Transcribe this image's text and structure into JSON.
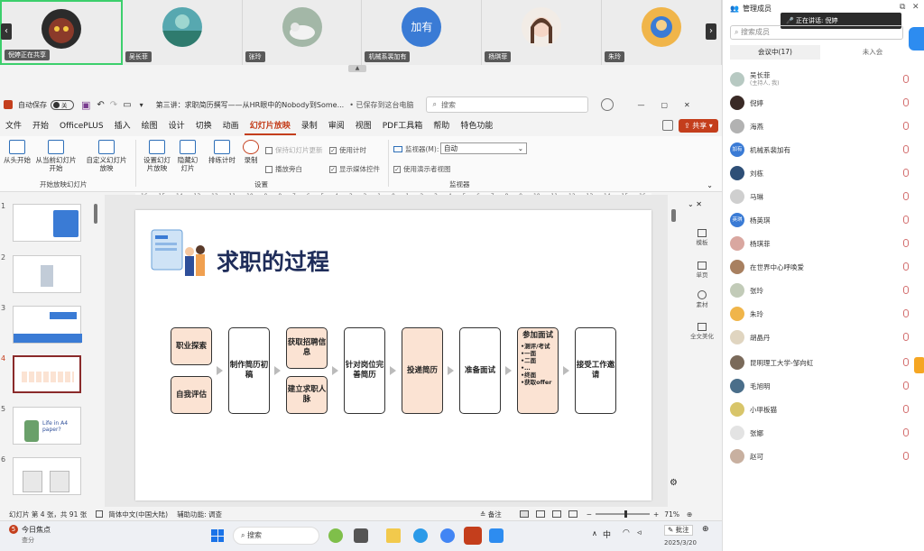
{
  "video_strip": {
    "tiles": [
      {
        "name": "倪婷正在共享",
        "avatar_color": "#2b2b2b",
        "active": true
      },
      {
        "name": "吴长菲",
        "avatar_color": "#57a8b0"
      },
      {
        "name": "张玲",
        "avatar_color": "#a3b7a7"
      },
      {
        "name": "机械系裴加有",
        "avatar_text": "加有",
        "avatar_color": "#3a7bd5"
      },
      {
        "name": "杨琪菲",
        "avatar_color": "#d9c4b8"
      },
      {
        "name": "朱玲",
        "avatar_color": "#f0b54a"
      }
    ],
    "left_arrow": "‹",
    "right_arrow": "›"
  },
  "titlebar": {
    "autosave_label": "自动保存",
    "autosave_state": "关",
    "doc_title": "第三讲：求职简历撰写——从HR眼中的Nobody到Some...",
    "save_status": "• 已保存到这台电脑",
    "search_placeholder": "搜索"
  },
  "menubar": {
    "items": [
      "文件",
      "开始",
      "OfficePLUS",
      "插入",
      "绘图",
      "设计",
      "切换",
      "动画",
      "幻灯片放映",
      "录制",
      "审阅",
      "视图",
      "PDF工具箱",
      "帮助",
      "特色功能"
    ],
    "selected_index": 8,
    "share_label": "共享"
  },
  "ribbon": {
    "btn_from_start": "从头开始",
    "btn_from_current": "从当前幻灯片开始",
    "btn_custom": "自定义幻灯片放映",
    "group_start": "开始放映幻灯片",
    "btn_setup": "设置幻灯片放映",
    "btn_hide": "隐藏幻灯片",
    "btn_rehearse": "排练计时",
    "btn_record": "录制",
    "chk_keep_updated": "保持幻灯片更新",
    "chk_narration": "播放旁白",
    "chk_timing": "使用计时",
    "chk_media": "显示媒体控件",
    "group_setup": "设置",
    "monitor_label": "监视器(M):",
    "monitor_value": "自动",
    "chk_presenter": "使用演示者视图",
    "group_monitor": "监视器"
  },
  "ruler": {
    "numbers": [
      "16",
      "15",
      "14",
      "13",
      "12",
      "11",
      "10",
      "9",
      "8",
      "7",
      "6",
      "5",
      "4",
      "3",
      "2",
      "1",
      "0",
      "1",
      "2",
      "3",
      "4",
      "5",
      "6",
      "7",
      "8",
      "9",
      "10",
      "11",
      "12",
      "13",
      "14",
      "15",
      "16"
    ]
  },
  "slide": {
    "title": "求职的过程",
    "boxes": {
      "job_explore": "职业探索",
      "self_assess": "自我评估",
      "make_resume": "制作简历初稿",
      "get_info": "获取招聘信息",
      "build_network": "建立求职人脉",
      "tailor_resume": "针对岗位完善简历",
      "submit_resume": "投递简历",
      "prepare_interview": "准备面试",
      "attend_title": "参加面试",
      "attend_items": [
        "•测评/考试",
        "•一面",
        "•二面",
        "•…",
        "•终面",
        "•获取offer"
      ],
      "accept": "接受工作邀请"
    }
  },
  "thumbnails": [
    {
      "num": "1"
    },
    {
      "num": "2"
    },
    {
      "num": "3"
    },
    {
      "num": "4",
      "selected": true
    },
    {
      "num": "5"
    },
    {
      "num": "6"
    }
  ],
  "side_tools": [
    "模板",
    "单页",
    "素材",
    "全文美化"
  ],
  "status": {
    "slide_info": "幻灯片 第 4 张，共 91 张",
    "language": "简体中文(中国大陆)",
    "accessibility": "辅助功能: 调查",
    "notes": "备注",
    "zoom": "71%"
  },
  "taskbar": {
    "weather_badge": "5",
    "weather_title": "今日焦点",
    "weather_sub": "查分",
    "search": "搜索",
    "ime": "中",
    "date": "2025/3/20",
    "annotate": "批注"
  },
  "right_pane": {
    "header": "管理成员",
    "speaking_label": "正在讲话:",
    "speaking_name": "倪婷",
    "search_placeholder": "搜索成员",
    "tab_in": "会议中(17)",
    "tab_out": "未入会",
    "members": [
      {
        "name": "吴长菲",
        "sub": "(主持人, 我)",
        "color": "#b7c9c2"
      },
      {
        "name": "倪婷",
        "color": "#3a2a26"
      },
      {
        "name": "海燕",
        "color": "#b2b2b2"
      },
      {
        "name": "机械系裴加有",
        "color": "#3a7bd5",
        "text": "加有"
      },
      {
        "name": "刘栋",
        "color": "#2e4f77"
      },
      {
        "name": "马琳",
        "color": "#cfcfcf"
      },
      {
        "name": "杨英琪",
        "color": "#3a7bd5",
        "text": "英琪"
      },
      {
        "name": "杨琪菲",
        "color": "#d9a7a0"
      },
      {
        "name": "在世界中心呼唤爱",
        "color": "#a88060"
      },
      {
        "name": "张玲",
        "color": "#c2cbb8"
      },
      {
        "name": "朱玲",
        "color": "#f0b54a"
      },
      {
        "name": "胡晶丹",
        "color": "#e0d5c0"
      },
      {
        "name": "昆明理工大学-邹向虹",
        "color": "#7a6a5a"
      },
      {
        "name": "毛旭明",
        "color": "#4a6e8a"
      },
      {
        "name": "小甲板猫",
        "color": "#d8c56a"
      },
      {
        "name": "张娜",
        "color": "#e3e3e3"
      },
      {
        "name": "赵可",
        "color": "#c8b0a0"
      }
    ]
  }
}
